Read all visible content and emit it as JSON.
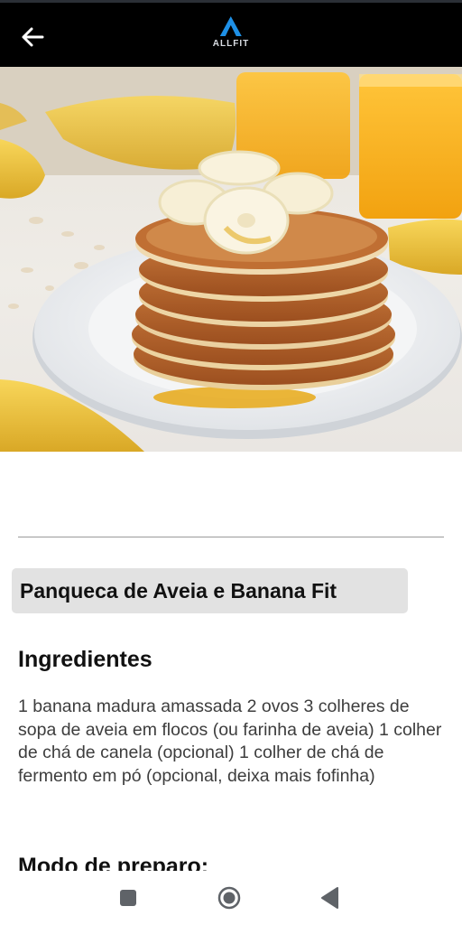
{
  "app": {
    "logo_text": "ALLFIT",
    "back_icon": "arrow-left-icon",
    "background": "#000000"
  },
  "hero": {
    "image": "pancake-stack-with-banana-slices",
    "alt": "Panqueca de aveia e banana"
  },
  "recipe": {
    "title": "Panqueca de Aveia e Banana Fit",
    "ingredients_heading": "Ingredientes",
    "ingredients_text": "1 banana madura amassada 2 ovos 3 colheres de sopa de aveia em flocos (ou farinha de aveia) 1 colher de chá de canela (opcional) 1 colher de chá de fermento em pó (opcional, deixa mais fofinha)",
    "prep_heading": "Modo de preparo:"
  },
  "nav": {
    "recents_icon": "square-recents-icon",
    "home_icon": "circle-home-icon",
    "back_icon": "triangle-back-icon"
  },
  "colors": {
    "title_bg": "#e2e2e2",
    "divider": "#9a9a9a",
    "body_text": "#3d3d3d",
    "logo_blue": "#1e90e6"
  }
}
